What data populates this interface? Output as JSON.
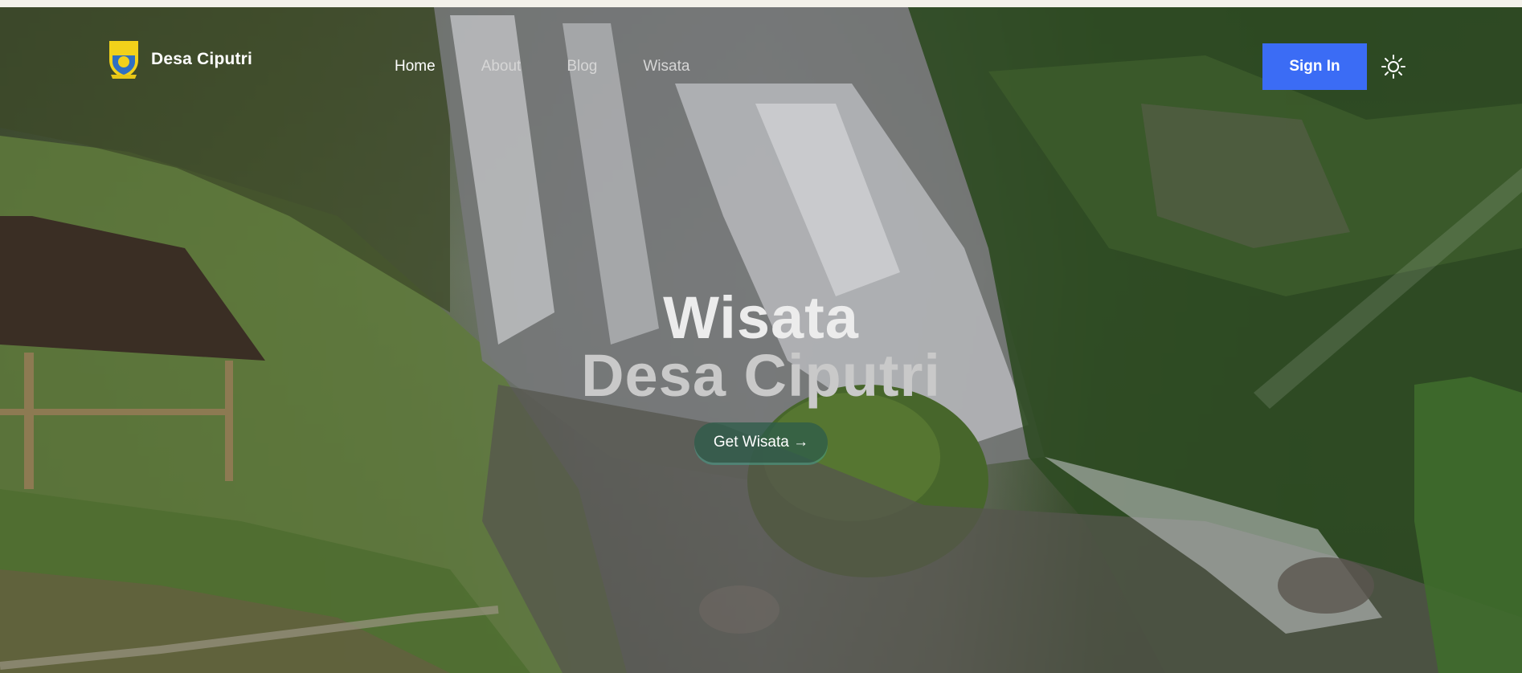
{
  "brand": {
    "name": "Desa Ciputri",
    "logo_icon": "village-crest-icon"
  },
  "nav": {
    "items": [
      {
        "label": "Home",
        "active": true
      },
      {
        "label": "About",
        "active": false
      },
      {
        "label": "Blog",
        "active": false
      },
      {
        "label": "Wisata",
        "active": false
      }
    ]
  },
  "header": {
    "signin_label": "Sign In",
    "theme_icon": "sun-icon"
  },
  "hero": {
    "title_line1": "Wisata",
    "title_line2": "Desa Ciputri",
    "cta_label": "Get Wisata →",
    "background": "waterfall-landscape-photo"
  },
  "colors": {
    "accent": "#3b6cf5",
    "cta_bg": "#2e5c4a",
    "top_strip": "#f3f1ea"
  }
}
